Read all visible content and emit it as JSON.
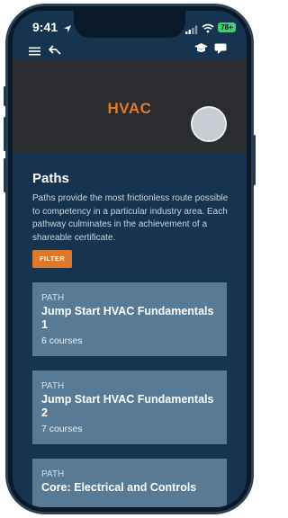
{
  "status_bar": {
    "time": "9:41",
    "battery": "78+",
    "icons": [
      "location-arrow-icon",
      "signal-icon",
      "wifi-icon",
      "battery-icon"
    ]
  },
  "navbar": {
    "icons": [
      "menu-icon",
      "back-icon",
      "graduation-cap-icon",
      "chat-icon"
    ]
  },
  "hero": {
    "title": "HVAC"
  },
  "paths": {
    "heading": "Paths",
    "description": "Paths provide the most frictionless route possible to competency in a particular industry area. Each pathway culminates in the achievement of a shareable certificate.",
    "filter_label": "FILTER",
    "cards": [
      {
        "type": "PATH",
        "title": "Jump Start HVAC Fundamentals 1",
        "count": "6 courses"
      },
      {
        "type": "PATH",
        "title": "Jump Start HVAC Fundamentals 2",
        "count": "7 courses"
      },
      {
        "type": "PATH",
        "title": "Core: Electrical and Controls",
        "count": ""
      }
    ]
  },
  "colors": {
    "background": "#163450",
    "hero_bg": "#2b2c2f",
    "accent": "#e0782c",
    "card_bg": "#587a94"
  }
}
